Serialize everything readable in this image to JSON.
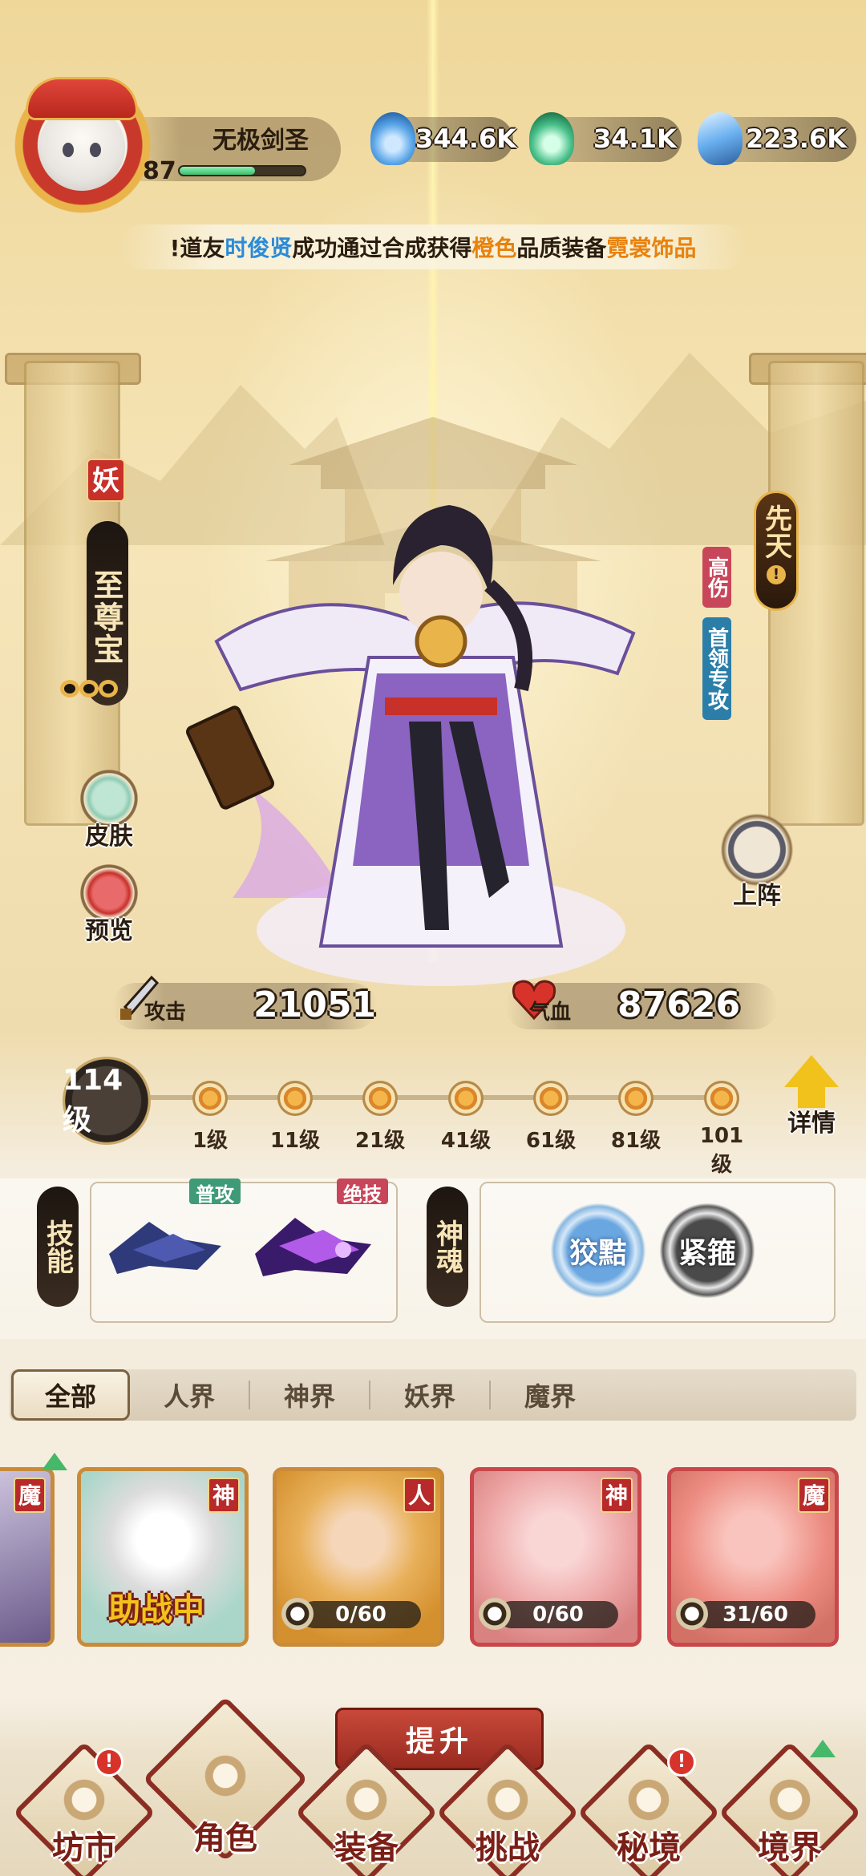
{
  "player": {
    "name": "无极剑圣",
    "level": "87",
    "exp_fraction": 0.6
  },
  "resources": [
    {
      "icon": "blue-flame-icon",
      "value": "344.6K",
      "color": "#5aa6e8"
    },
    {
      "icon": "green-flame-icon",
      "value": "34.1K",
      "color": "#49c08a"
    },
    {
      "icon": "blue-crystal-icon",
      "value": "223.6K",
      "color": "#6ab0f0"
    }
  ],
  "ticker": {
    "prefix": "!道友",
    "name": "时俊贤",
    "mid1": "成功通过合成获得",
    "quality": "橙色",
    "mid2": "品质装备",
    "item": "霓裳饰品"
  },
  "hero": {
    "race_tag": "妖",
    "title": "至尊宝",
    "innate": "先天",
    "innate_mark": "!",
    "tag_high": "高伤",
    "tag_boss": "首领专攻",
    "attack_label": "攻击",
    "attack_value": "21051",
    "hp_label": "气血",
    "hp_value": "87626",
    "level_badge": "114级",
    "milestones": [
      "1级",
      "11级",
      "21级",
      "41级",
      "61级",
      "81级",
      "101级"
    ]
  },
  "side": {
    "skin": "皮肤",
    "preview": "预览",
    "deploy": "上阵",
    "detail": "详情"
  },
  "skills": {
    "label": "技能",
    "normal_tag": "普攻",
    "ultimate_tag": "绝技"
  },
  "souls": {
    "label": "神魂",
    "items": [
      "狡黠",
      "紧箍"
    ]
  },
  "tabs": [
    "全部",
    "人界",
    "神界",
    "妖界",
    "魔界"
  ],
  "cards": [
    {
      "race": "魔",
      "progress": ""
    },
    {
      "race": "神",
      "progress": "",
      "status": "助战中"
    },
    {
      "race": "人",
      "progress": "0/60"
    },
    {
      "race": "神",
      "progress": "0/60"
    },
    {
      "race": "魔",
      "progress": "31/60"
    }
  ],
  "upgrade": "提升",
  "nav": [
    {
      "label": "坊市",
      "icon": "market-icon",
      "badge": "!"
    },
    {
      "label": "角色",
      "icon": "character-icon",
      "badge": ""
    },
    {
      "label": "装备",
      "icon": "equipment-icon",
      "badge": ""
    },
    {
      "label": "挑战",
      "icon": "crossed-swords-icon",
      "badge": ""
    },
    {
      "label": "秘境",
      "icon": "secret-realm-icon",
      "badge": "!"
    },
    {
      "label": "境界",
      "icon": "realm-icon",
      "badge": ""
    }
  ]
}
